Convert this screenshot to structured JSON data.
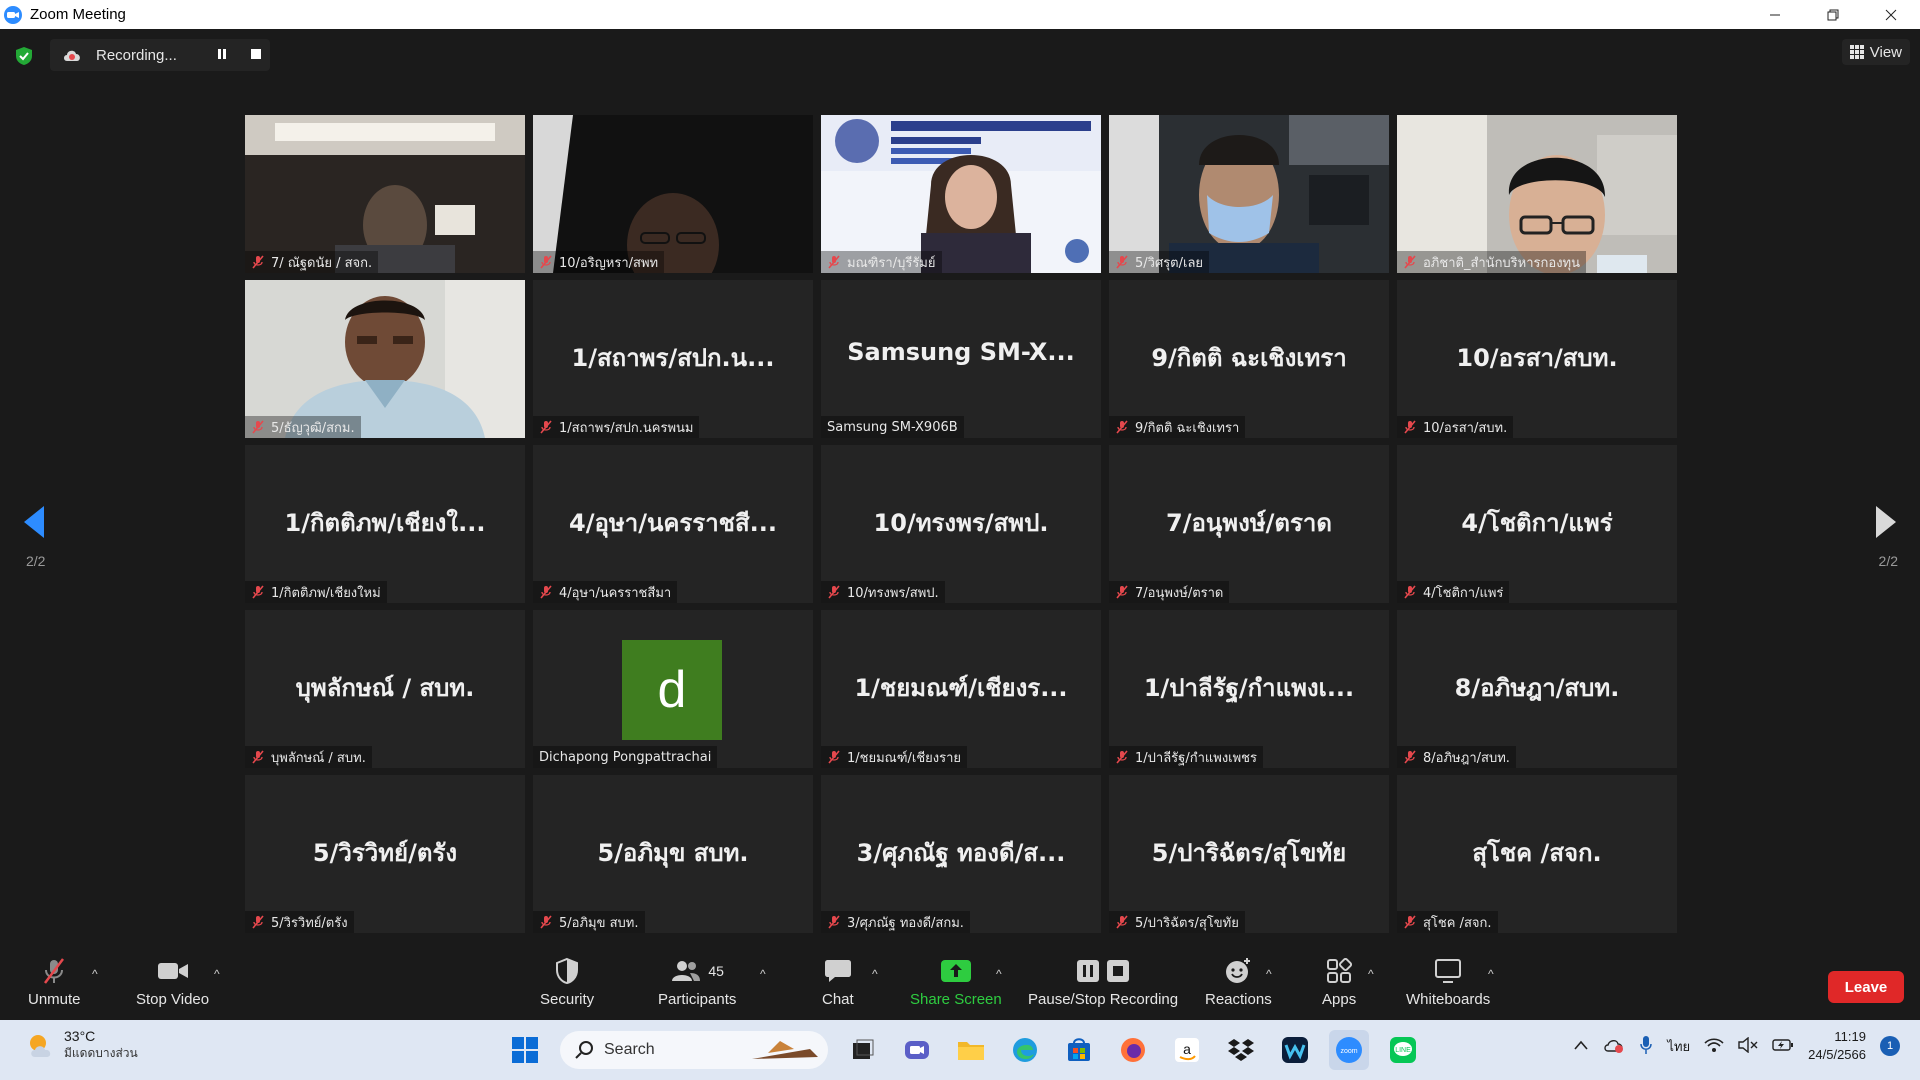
{
  "window": {
    "title": "Zoom Meeting"
  },
  "top": {
    "recording_label": "Recording...",
    "view_label": "View"
  },
  "pager": {
    "left": "2/2",
    "right": "2/2"
  },
  "tiles": [
    {
      "big": "",
      "label": "7/ ณัฐดนัย / สจก.",
      "muted": true,
      "video": "room"
    },
    {
      "big": "",
      "label": "10/อริญหรา/สพท",
      "muted": true,
      "video": "dark-person"
    },
    {
      "big": "",
      "label": "มณฑิรา/บุรีรัมย์",
      "muted": true,
      "video": "banner-woman"
    },
    {
      "big": "",
      "label": "5/วิศรุต/เลย",
      "muted": true,
      "video": "mask-man"
    },
    {
      "big": "",
      "label": "อภิชาติ_สำนักบริหารกองทุน",
      "muted": true,
      "video": "glasses-man"
    },
    {
      "big": "",
      "label": "5/ธัญวุฒิ/สกม.",
      "muted": true,
      "video": "blue-shirt"
    },
    {
      "big": "1/สถาพร/สปก.น...",
      "label": "1/สถาพร/สปก.นครพนม",
      "muted": true,
      "video": ""
    },
    {
      "big": "Samsung SM-X...",
      "label": "Samsung SM-X906B",
      "muted": false,
      "video": ""
    },
    {
      "big": "9/กิตติ ฉะเชิงเทรา",
      "label": "9/กิตติ ฉะเชิงเทรา",
      "muted": true,
      "video": ""
    },
    {
      "big": "10/อรสา/สบท.",
      "label": "10/อรสา/สบท.",
      "muted": true,
      "video": ""
    },
    {
      "big": "1/กิตติภพ/เชียงใ...",
      "label": "1/กิตติภพ/เชียงใหม่",
      "muted": true,
      "video": ""
    },
    {
      "big": "4/อุษา/นครราชสี...",
      "label": "4/อุษา/นครราชสีมา",
      "muted": true,
      "video": ""
    },
    {
      "big": "10/ทรงพร/สพป.",
      "label": "10/ทรงพร/สพป.",
      "muted": true,
      "video": ""
    },
    {
      "big": "7/อนุพงษ์/ตราด",
      "label": "7/อนุพงษ์/ตราด",
      "muted": true,
      "video": ""
    },
    {
      "big": "4/โชติกา/แพร่",
      "label": "4/โชติกา/แพร่",
      "muted": true,
      "video": ""
    },
    {
      "big": "บุพลักษณ์ / สบท.",
      "label": "บุพลักษณ์ / สบท.",
      "muted": true,
      "video": ""
    },
    {
      "big": "",
      "label": "Dichapong Pongpattrachai",
      "muted": false,
      "video": "avatar",
      "avatar": "d"
    },
    {
      "big": "1/ชยมณฑ์/เชียงร...",
      "label": "1/ชยมณฑ์/เชียงราย",
      "muted": true,
      "video": ""
    },
    {
      "big": "1/ปาลีรัฐ/กำแพงเ...",
      "label": "1/ปาลีรัฐ/กำแพงเพชร",
      "muted": true,
      "video": ""
    },
    {
      "big": "8/อภิษฎา/สบท.",
      "label": "8/อภิษฎา/สบท.",
      "muted": true,
      "video": ""
    },
    {
      "big": "5/วิรวิทย์/ตรัง",
      "label": "5/วิรวิทย์/ตรัง",
      "muted": true,
      "video": ""
    },
    {
      "big": "5/อภิมุข สบท.",
      "label": "5/อภิมุข สบท.",
      "muted": true,
      "video": ""
    },
    {
      "big": "3/ศุภณัฐ ทองดี/ส...",
      "label": "3/ศุภณัฐ ทองดี/สกม.",
      "muted": true,
      "video": ""
    },
    {
      "big": "5/ปาริฉัตร/สุโขทัย",
      "label": "5/ปาริฉัตร/สุโขทัย",
      "muted": true,
      "video": ""
    },
    {
      "big": "สุโชค /สจก.",
      "label": "สุโชค /สจก.",
      "muted": true,
      "video": ""
    }
  ],
  "toolbar": {
    "unmute": "Unmute",
    "stop_video": "Stop Video",
    "security": "Security",
    "participants": "Participants",
    "participants_count": "45",
    "chat": "Chat",
    "share_screen": "Share Screen",
    "recording": "Pause/Stop Recording",
    "reactions": "Reactions",
    "apps": "Apps",
    "whiteboards": "Whiteboards",
    "leave": "Leave"
  },
  "taskbar": {
    "temp": "33°C",
    "condition": "มีแดดบางส่วน",
    "search": "Search",
    "lang": "ไทย",
    "time": "11:19",
    "date": "24/5/2566",
    "notifications": "1"
  },
  "colors": {
    "share_green": "#2ecc40",
    "leave_red": "#e02828",
    "accent_blue": "#2d8cff",
    "mute_red": "#e5484d"
  }
}
